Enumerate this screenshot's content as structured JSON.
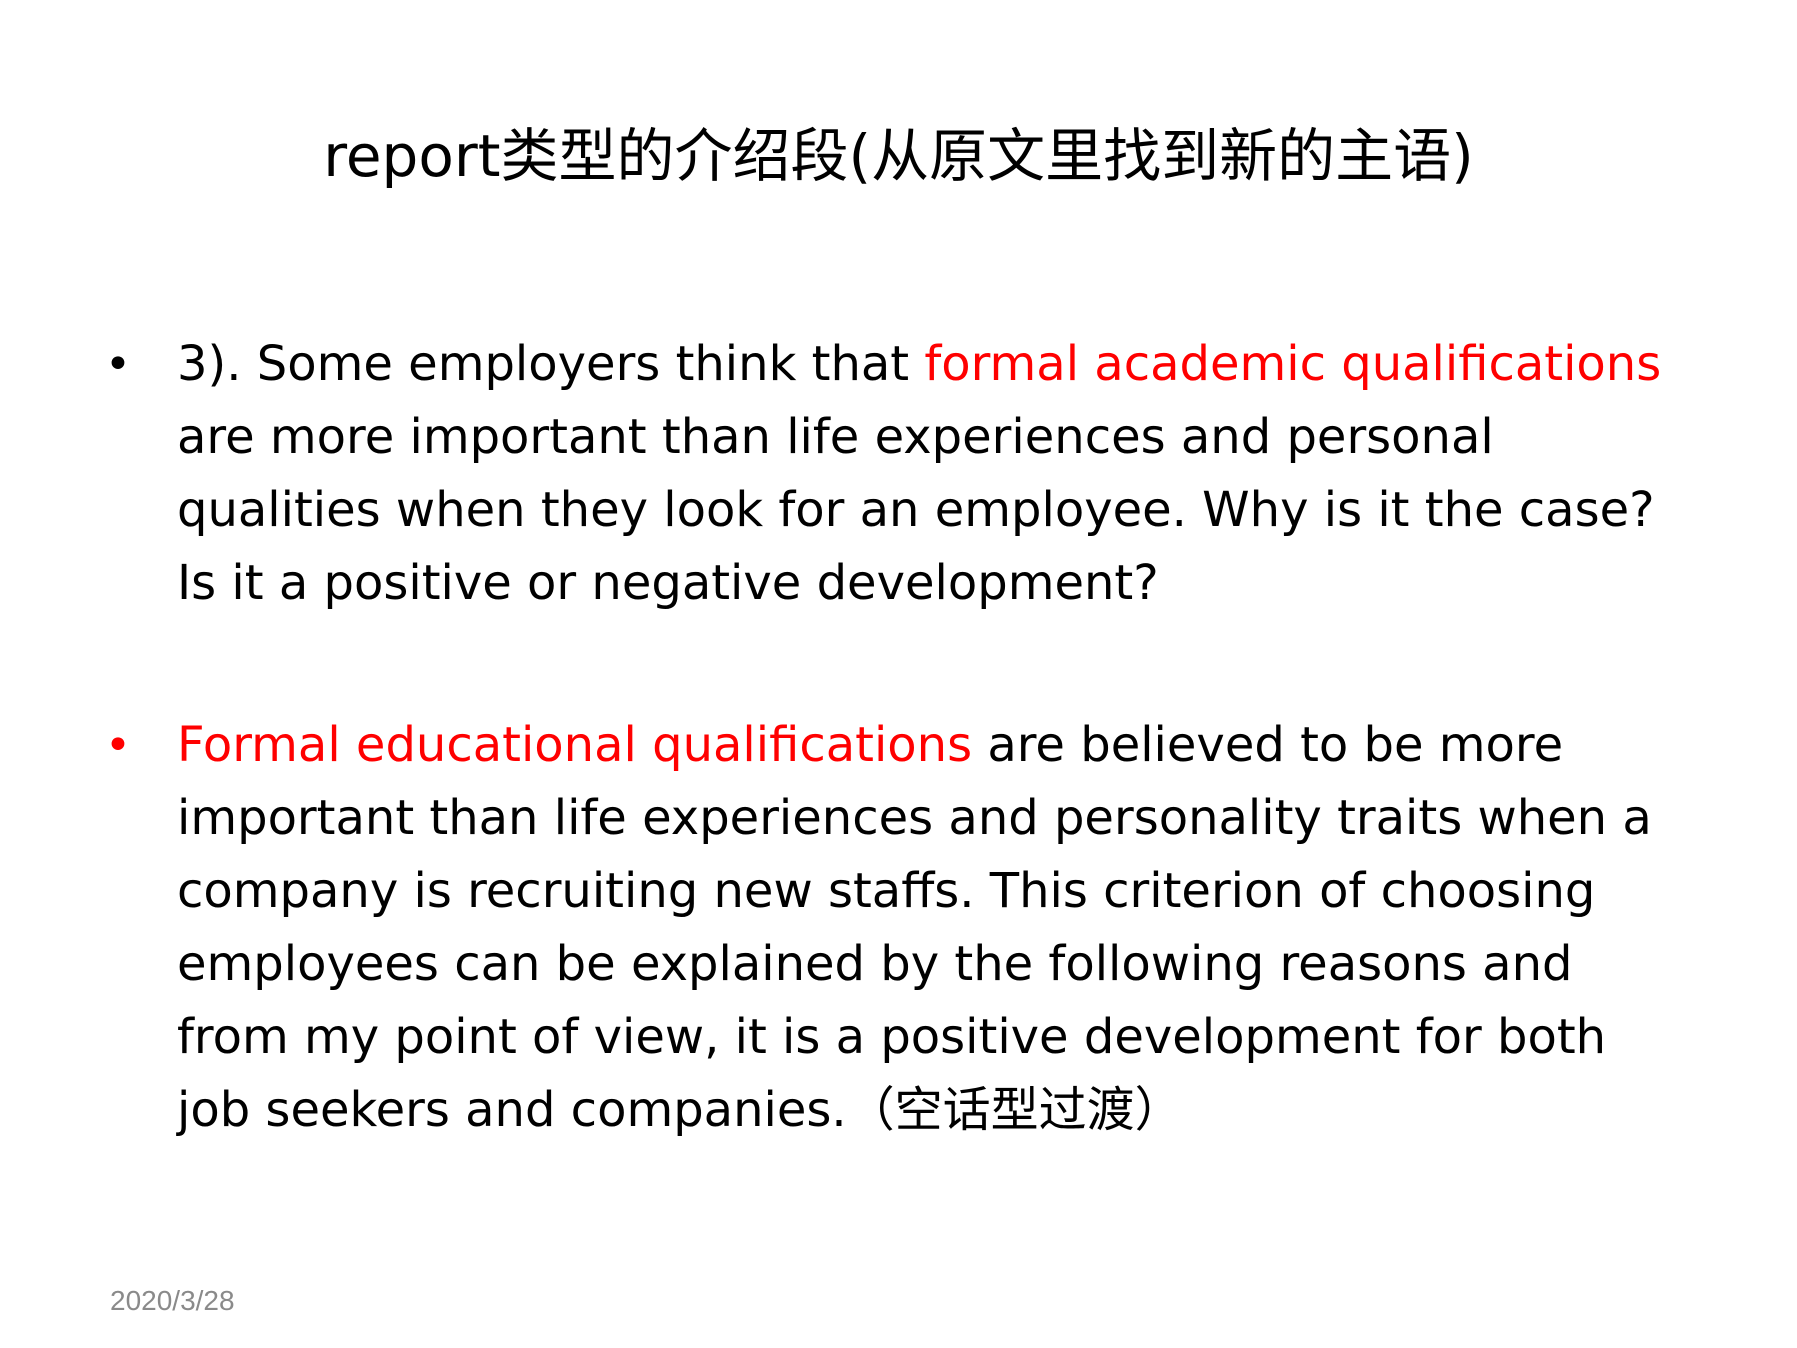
{
  "slide": {
    "title": "report类型的介绍段(从原文里找到新的主语)",
    "bullets": [
      {
        "marker": "•",
        "marker_color": "#000000",
        "lines": [
          {
            "prefix": "3). Some employers think that ",
            "highlight": "formal academic qualifications"
          },
          {
            "text": "are more important than life experiences and personal"
          },
          {
            "text": "qualities when they look for an employee. Why is it the case?"
          },
          {
            "text": "Is it a positive or negative development?"
          }
        ]
      },
      {
        "marker": "•",
        "marker_color": "#ff0000",
        "lines": [
          {
            "highlight": "Formal educational qualifications",
            "suffix": " are believed to be more"
          },
          {
            "text": "important than life experiences and personality traits when a"
          },
          {
            "text": "company is recruiting new staffs. This criterion of choosing"
          },
          {
            "text": "employees can be explained by the  following reasons and"
          },
          {
            "text": "from my point of view, it is a positive development for both"
          },
          {
            "text": "job seekers and companies.（空话型过渡）"
          }
        ]
      }
    ],
    "date": "2020/3/28"
  },
  "colors": {
    "text": "#000000",
    "highlight": "#ff0000",
    "date": "#8a8a8a",
    "background": "#ffffff"
  }
}
